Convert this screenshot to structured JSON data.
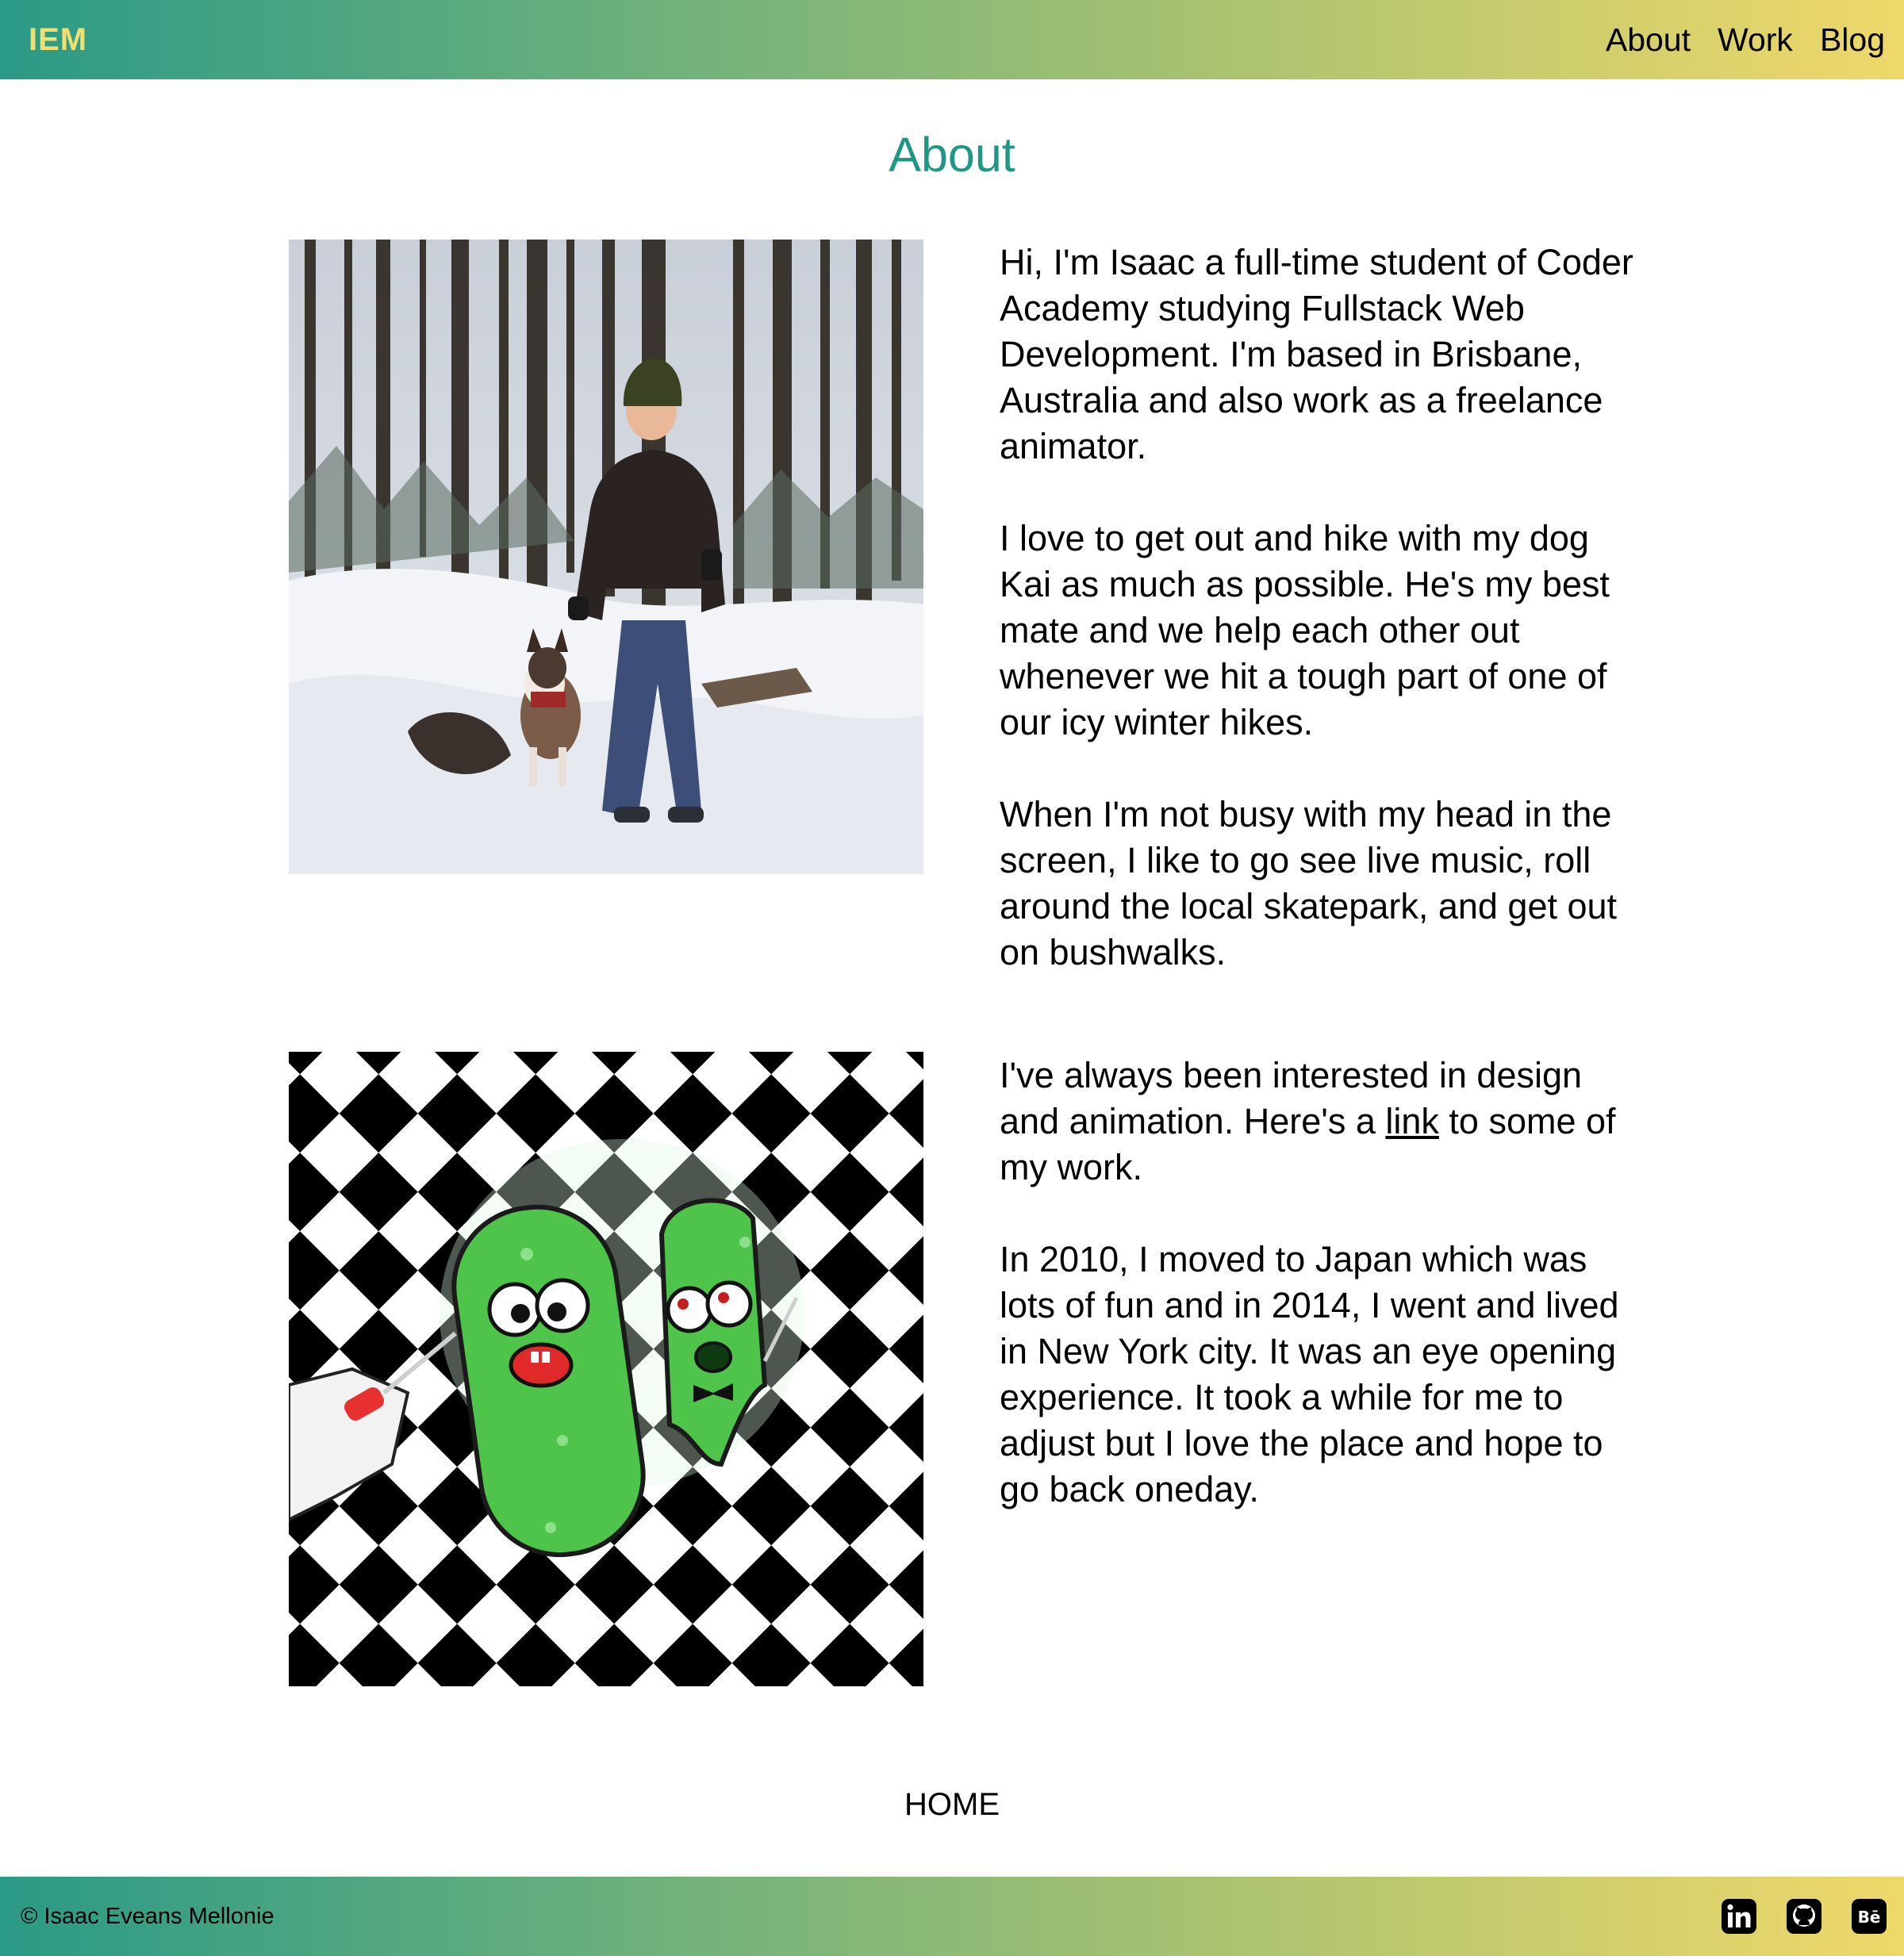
{
  "header": {
    "brand": "IEM",
    "nav": [
      {
        "label": "About"
      },
      {
        "label": "Work"
      },
      {
        "label": "Blog"
      }
    ]
  },
  "main": {
    "title": "About",
    "section1": {
      "paragraphs": [
        "Hi, I'm Isaac a full-time student of Coder Academy studying Fullstack Web Development. I'm based in Brisbane, Australia and also work as a freelance animator.",
        "I love to get out and hike with my dog Kai as much as possible. He's my best mate and we help each other out whenever we hit a tough part of one of our icy winter hikes.",
        "When I'm not busy with my head in the screen, I like to go see live music, roll around the local skatepark, and get out on bushwalks."
      ]
    },
    "section2": {
      "p1_before": "I've always been interested in design and animation. Here's a ",
      "p1_link": "link",
      "p1_after": " to some of my work.",
      "p2": "In 2010, I moved to Japan which was lots of fun and in 2014, I went and lived in New York city. It was an eye opening experience. It took a while for me to adjust but I love the place and hope to go back oneday."
    },
    "home_link": "HOME"
  },
  "footer": {
    "copyright": "© Isaac Eveans Mellonie",
    "socials": [
      {
        "icon": "linkedin-icon"
      },
      {
        "icon": "github-icon"
      },
      {
        "icon": "behance-icon"
      }
    ]
  },
  "colors": {
    "accent_teal": "#1f9787",
    "brand_yellow": "#f3de70",
    "gradient_start": "#2a9a86",
    "gradient_end": "#efd86a"
  }
}
